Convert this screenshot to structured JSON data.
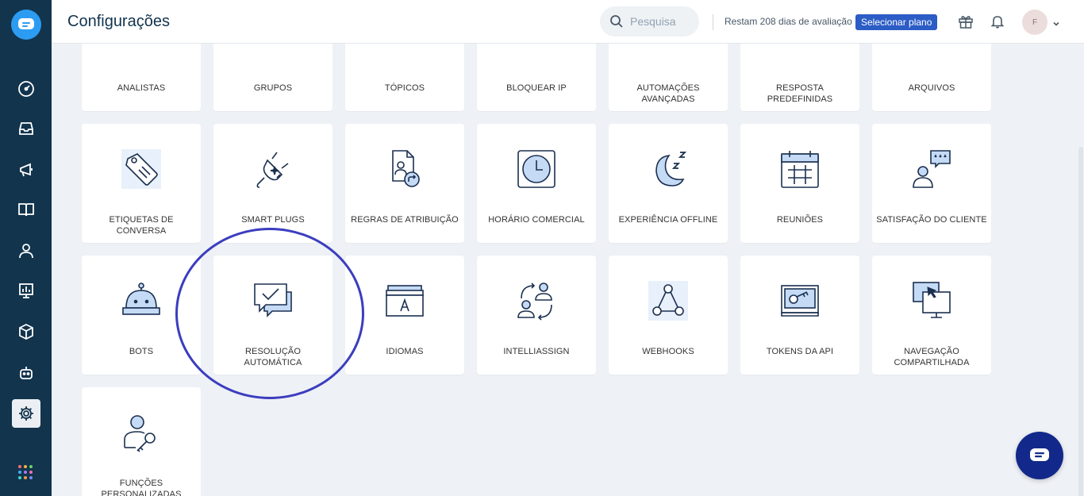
{
  "header": {
    "title": "Configurações",
    "search_placeholder": "Pesquisa",
    "trial_text": "Restam 208 dias de avaliação",
    "plan_button": "Selecionar plano",
    "avatar_initial": "F"
  },
  "sidebar": {
    "items": [
      "dashboard-icon",
      "inbox-icon",
      "megaphone-icon",
      "book-icon",
      "contact-icon",
      "analytics-icon",
      "cube-icon",
      "bot-icon",
      "settings-icon"
    ],
    "active": "settings-icon"
  },
  "tiles": [
    {
      "label": "ANALISTAS",
      "icon": "analysts-icon"
    },
    {
      "label": "GRUPOS",
      "icon": "groups-icon"
    },
    {
      "label": "TÓPICOS",
      "icon": "topics-icon"
    },
    {
      "label": "BLOQUEAR IP",
      "icon": "block-ip-icon"
    },
    {
      "label": "AUTOMAÇÕES AVANÇADAS",
      "icon": "automations-icon"
    },
    {
      "label": "RESPOSTA PREDEFINIDAS",
      "icon": "canned-responses-icon"
    },
    {
      "label": "ARQUIVOS",
      "icon": "files-icon"
    },
    {
      "label": "ETIQUETAS DE CONVERSA",
      "icon": "tag-icon"
    },
    {
      "label": "SMART PLUGS",
      "icon": "plug-icon"
    },
    {
      "label": "REGRAS DE ATRIBUIÇÃO",
      "icon": "assignment-rules-icon"
    },
    {
      "label": "HORÁRIO COMERCIAL",
      "icon": "clock-icon"
    },
    {
      "label": "EXPERIÊNCIA OFFLINE",
      "icon": "moon-icon"
    },
    {
      "label": "REUNIÕES",
      "icon": "calendar-icon"
    },
    {
      "label": "SATISFAÇÃO DO CLIENTE",
      "icon": "satisfaction-icon"
    },
    {
      "label": "BOTS",
      "icon": "bell-bot-icon"
    },
    {
      "label": "RESOLUÇÃO AUTOMÁTICA",
      "icon": "auto-resolve-icon"
    },
    {
      "label": "IDIOMAS",
      "icon": "languages-icon"
    },
    {
      "label": "INTELLIASSIGN",
      "icon": "intelliassign-icon"
    },
    {
      "label": "WEBHOOKS",
      "icon": "webhooks-icon"
    },
    {
      "label": "TOKENS DA API",
      "icon": "api-key-icon"
    },
    {
      "label": "NAVEGAÇÃO COMPARTILHADA",
      "icon": "cobrowse-icon"
    },
    {
      "label": "FUNÇÕES PERSONALIZADAS",
      "icon": "custom-roles-icon"
    }
  ],
  "colors": {
    "sidebar": "#12344d",
    "accent": "#2c5cc5",
    "annotation": "#3b3dbf",
    "icon_fill": "#c5daf5",
    "icon_stroke": "#1b3050"
  }
}
